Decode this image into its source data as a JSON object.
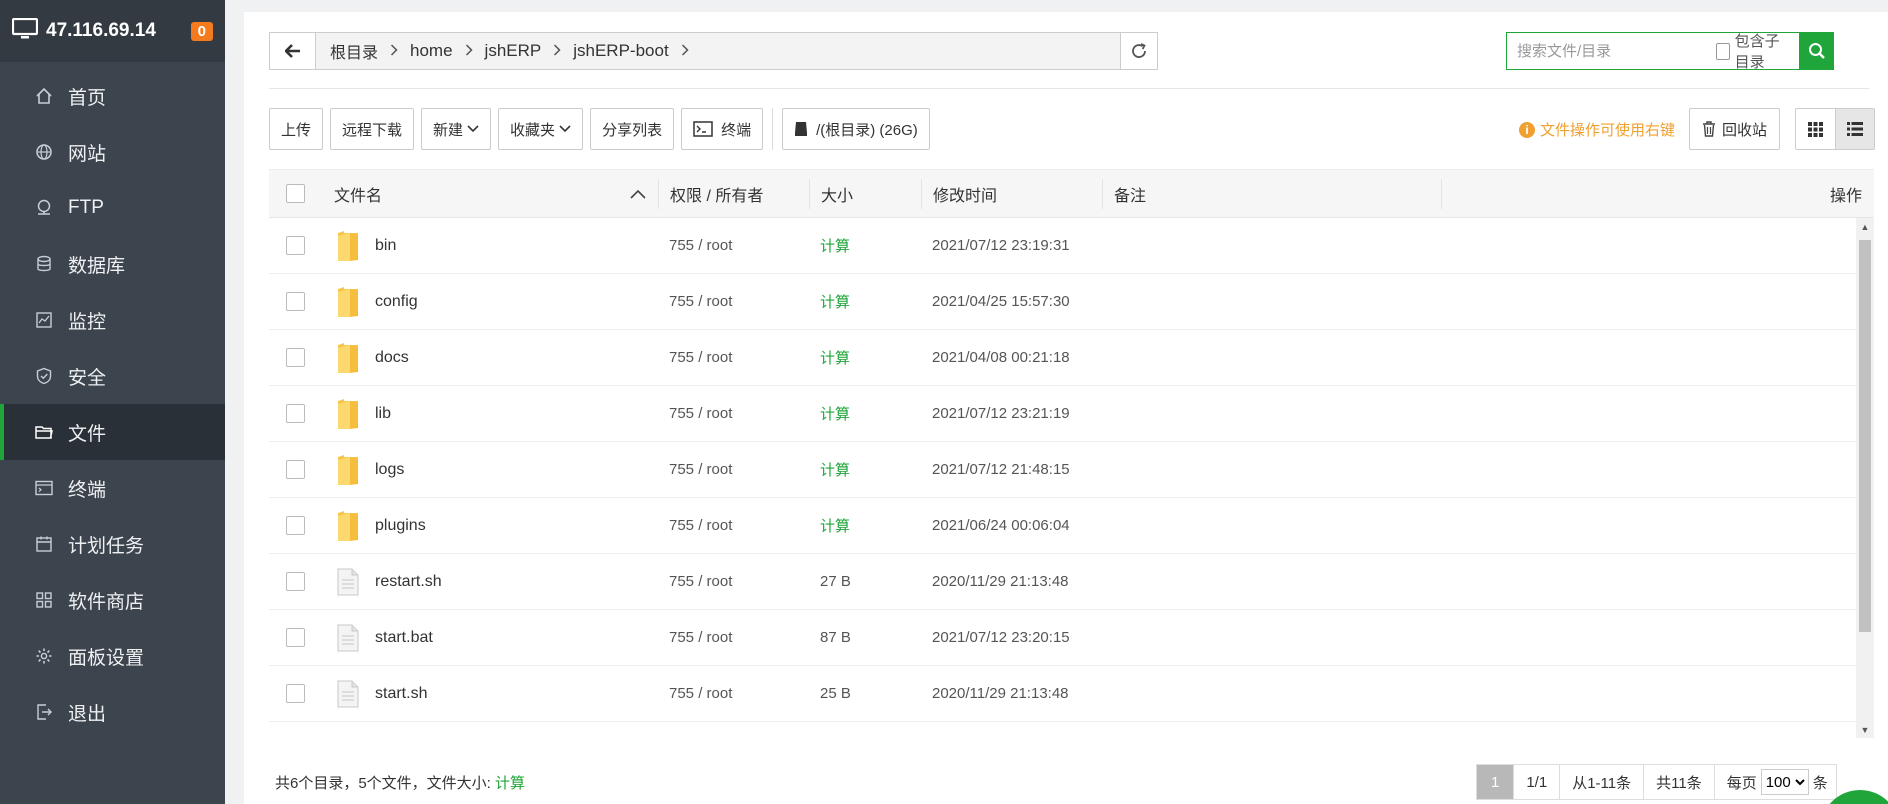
{
  "sidebar": {
    "ip": "47.116.69.14",
    "badge": "0",
    "items": [
      {
        "label": "首页",
        "icon": "home-icon"
      },
      {
        "label": "网站",
        "icon": "globe-icon"
      },
      {
        "label": "FTP",
        "icon": "ftp-icon"
      },
      {
        "label": "数据库",
        "icon": "database-icon"
      },
      {
        "label": "监控",
        "icon": "monitor-icon"
      },
      {
        "label": "安全",
        "icon": "shield-icon"
      },
      {
        "label": "文件",
        "icon": "folder-icon",
        "active": true
      },
      {
        "label": "终端",
        "icon": "terminal-icon"
      },
      {
        "label": "计划任务",
        "icon": "calendar-icon"
      },
      {
        "label": "软件商店",
        "icon": "grid-icon"
      },
      {
        "label": "面板设置",
        "icon": "gear-icon"
      },
      {
        "label": "退出",
        "icon": "logout-icon"
      }
    ]
  },
  "path": {
    "crumbs": [
      "根目录",
      "home",
      "jshERP",
      "jshERP-boot"
    ]
  },
  "search": {
    "placeholder": "搜索文件/目录",
    "include_sub": "包含子目录"
  },
  "toolbar": {
    "upload": "上传",
    "remote_download": "远程下载",
    "new": "新建",
    "favorites": "收藏夹",
    "share_list": "分享列表",
    "terminal": "终端",
    "disk": "/(根目录) (26G)",
    "tip": "文件操作可使用右键",
    "recycle": "回收站"
  },
  "table": {
    "headers": {
      "name": "文件名",
      "perm": "权限 / 所有者",
      "size": "大小",
      "time": "修改时间",
      "note": "备注",
      "op": "操作"
    },
    "rows": [
      {
        "name": "bin",
        "type": "folder",
        "perm": "755 / root",
        "size": "计算",
        "time": "2021/07/12 23:19:31"
      },
      {
        "name": "config",
        "type": "folder",
        "perm": "755 / root",
        "size": "计算",
        "time": "2021/04/25 15:57:30"
      },
      {
        "name": "docs",
        "type": "folder",
        "perm": "755 / root",
        "size": "计算",
        "time": "2021/04/08 00:21:18"
      },
      {
        "name": "lib",
        "type": "folder",
        "perm": "755 / root",
        "size": "计算",
        "time": "2021/07/12 23:21:19"
      },
      {
        "name": "logs",
        "type": "folder",
        "perm": "755 / root",
        "size": "计算",
        "time": "2021/07/12 21:48:15"
      },
      {
        "name": "plugins",
        "type": "folder",
        "perm": "755 / root",
        "size": "计算",
        "time": "2021/06/24 00:06:04"
      },
      {
        "name": "restart.sh",
        "type": "file",
        "perm": "755 / root",
        "size": "27 B",
        "time": "2020/11/29 21:13:48"
      },
      {
        "name": "start.bat",
        "type": "file",
        "perm": "755 / root",
        "size": "87 B",
        "time": "2021/07/12 23:20:15"
      },
      {
        "name": "start.sh",
        "type": "file",
        "perm": "755 / root",
        "size": "25 B",
        "time": "2020/11/29 21:13:48"
      }
    ]
  },
  "footer": {
    "summary": "共6个目录，5个文件，文件大小:",
    "calc": "计算"
  },
  "pager": {
    "current": "1",
    "pages": "1/1",
    "range": "从1-11条",
    "total": "共11条",
    "per_page_label": "每页",
    "per_page_value": "100",
    "unit": "条"
  },
  "colors": {
    "accent": "#20a53a",
    "sidebar_bg": "#3c444d",
    "warning": "#f0a030",
    "badge": "#f37b1d"
  }
}
